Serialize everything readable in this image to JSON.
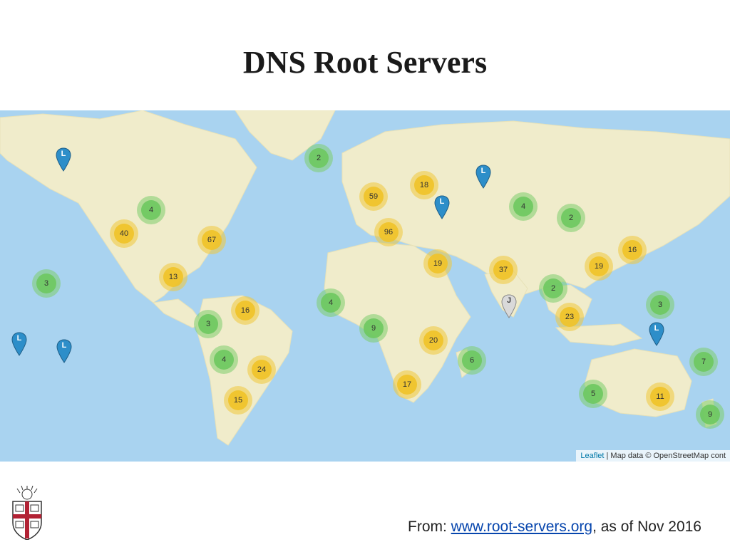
{
  "title": "DNS Root Servers",
  "map": {
    "clusters": [
      {
        "count": "2",
        "size": "small"
      },
      {
        "count": "4",
        "size": "small"
      },
      {
        "count": "40",
        "size": "medium"
      },
      {
        "count": "67",
        "size": "medium"
      },
      {
        "count": "13",
        "size": "medium"
      },
      {
        "count": "3",
        "size": "small"
      },
      {
        "count": "16",
        "size": "medium"
      },
      {
        "count": "3",
        "size": "small"
      },
      {
        "count": "4",
        "size": "small"
      },
      {
        "count": "24",
        "size": "medium"
      },
      {
        "count": "15",
        "size": "medium"
      },
      {
        "count": "59",
        "size": "medium"
      },
      {
        "count": "18",
        "size": "medium"
      },
      {
        "count": "96",
        "size": "medium"
      },
      {
        "count": "19",
        "size": "medium"
      },
      {
        "count": "4",
        "size": "small"
      },
      {
        "count": "9",
        "size": "small"
      },
      {
        "count": "20",
        "size": "medium"
      },
      {
        "count": "17",
        "size": "medium"
      },
      {
        "count": "6",
        "size": "small"
      },
      {
        "count": "37",
        "size": "medium"
      },
      {
        "count": "4",
        "size": "small"
      },
      {
        "count": "2",
        "size": "small"
      },
      {
        "count": "16",
        "size": "medium"
      },
      {
        "count": "19",
        "size": "medium"
      },
      {
        "count": "2",
        "size": "small"
      },
      {
        "count": "23",
        "size": "medium"
      },
      {
        "count": "3",
        "size": "small"
      },
      {
        "count": "7",
        "size": "small"
      },
      {
        "count": "5",
        "size": "small"
      },
      {
        "count": "11",
        "size": "medium"
      },
      {
        "count": "9",
        "size": "small"
      }
    ],
    "pins": [
      {
        "label": "L",
        "color": "#2d8ec9"
      },
      {
        "label": "L",
        "color": "#2d8ec9"
      },
      {
        "label": "L",
        "color": "#2d8ec9"
      },
      {
        "label": "L",
        "color": "#2d8ec9"
      },
      {
        "label": "L",
        "color": "#2d8ec9"
      },
      {
        "label": "J",
        "color": "#d9d9d9"
      },
      {
        "label": "L",
        "color": "#2d8ec9"
      }
    ],
    "colors": {
      "ocean": "#a9d3f0",
      "land": "#f0eccb",
      "small_cluster": "#7dcd6e",
      "medium_cluster": "#f0c33c"
    },
    "attribution": {
      "leaflet": "Leaflet",
      "rest": "| Map data © OpenStreetMap cont"
    }
  },
  "footer": {
    "prefix": "From: ",
    "link": "www.root-servers.org",
    "suffix": ", as of Nov 2016"
  }
}
